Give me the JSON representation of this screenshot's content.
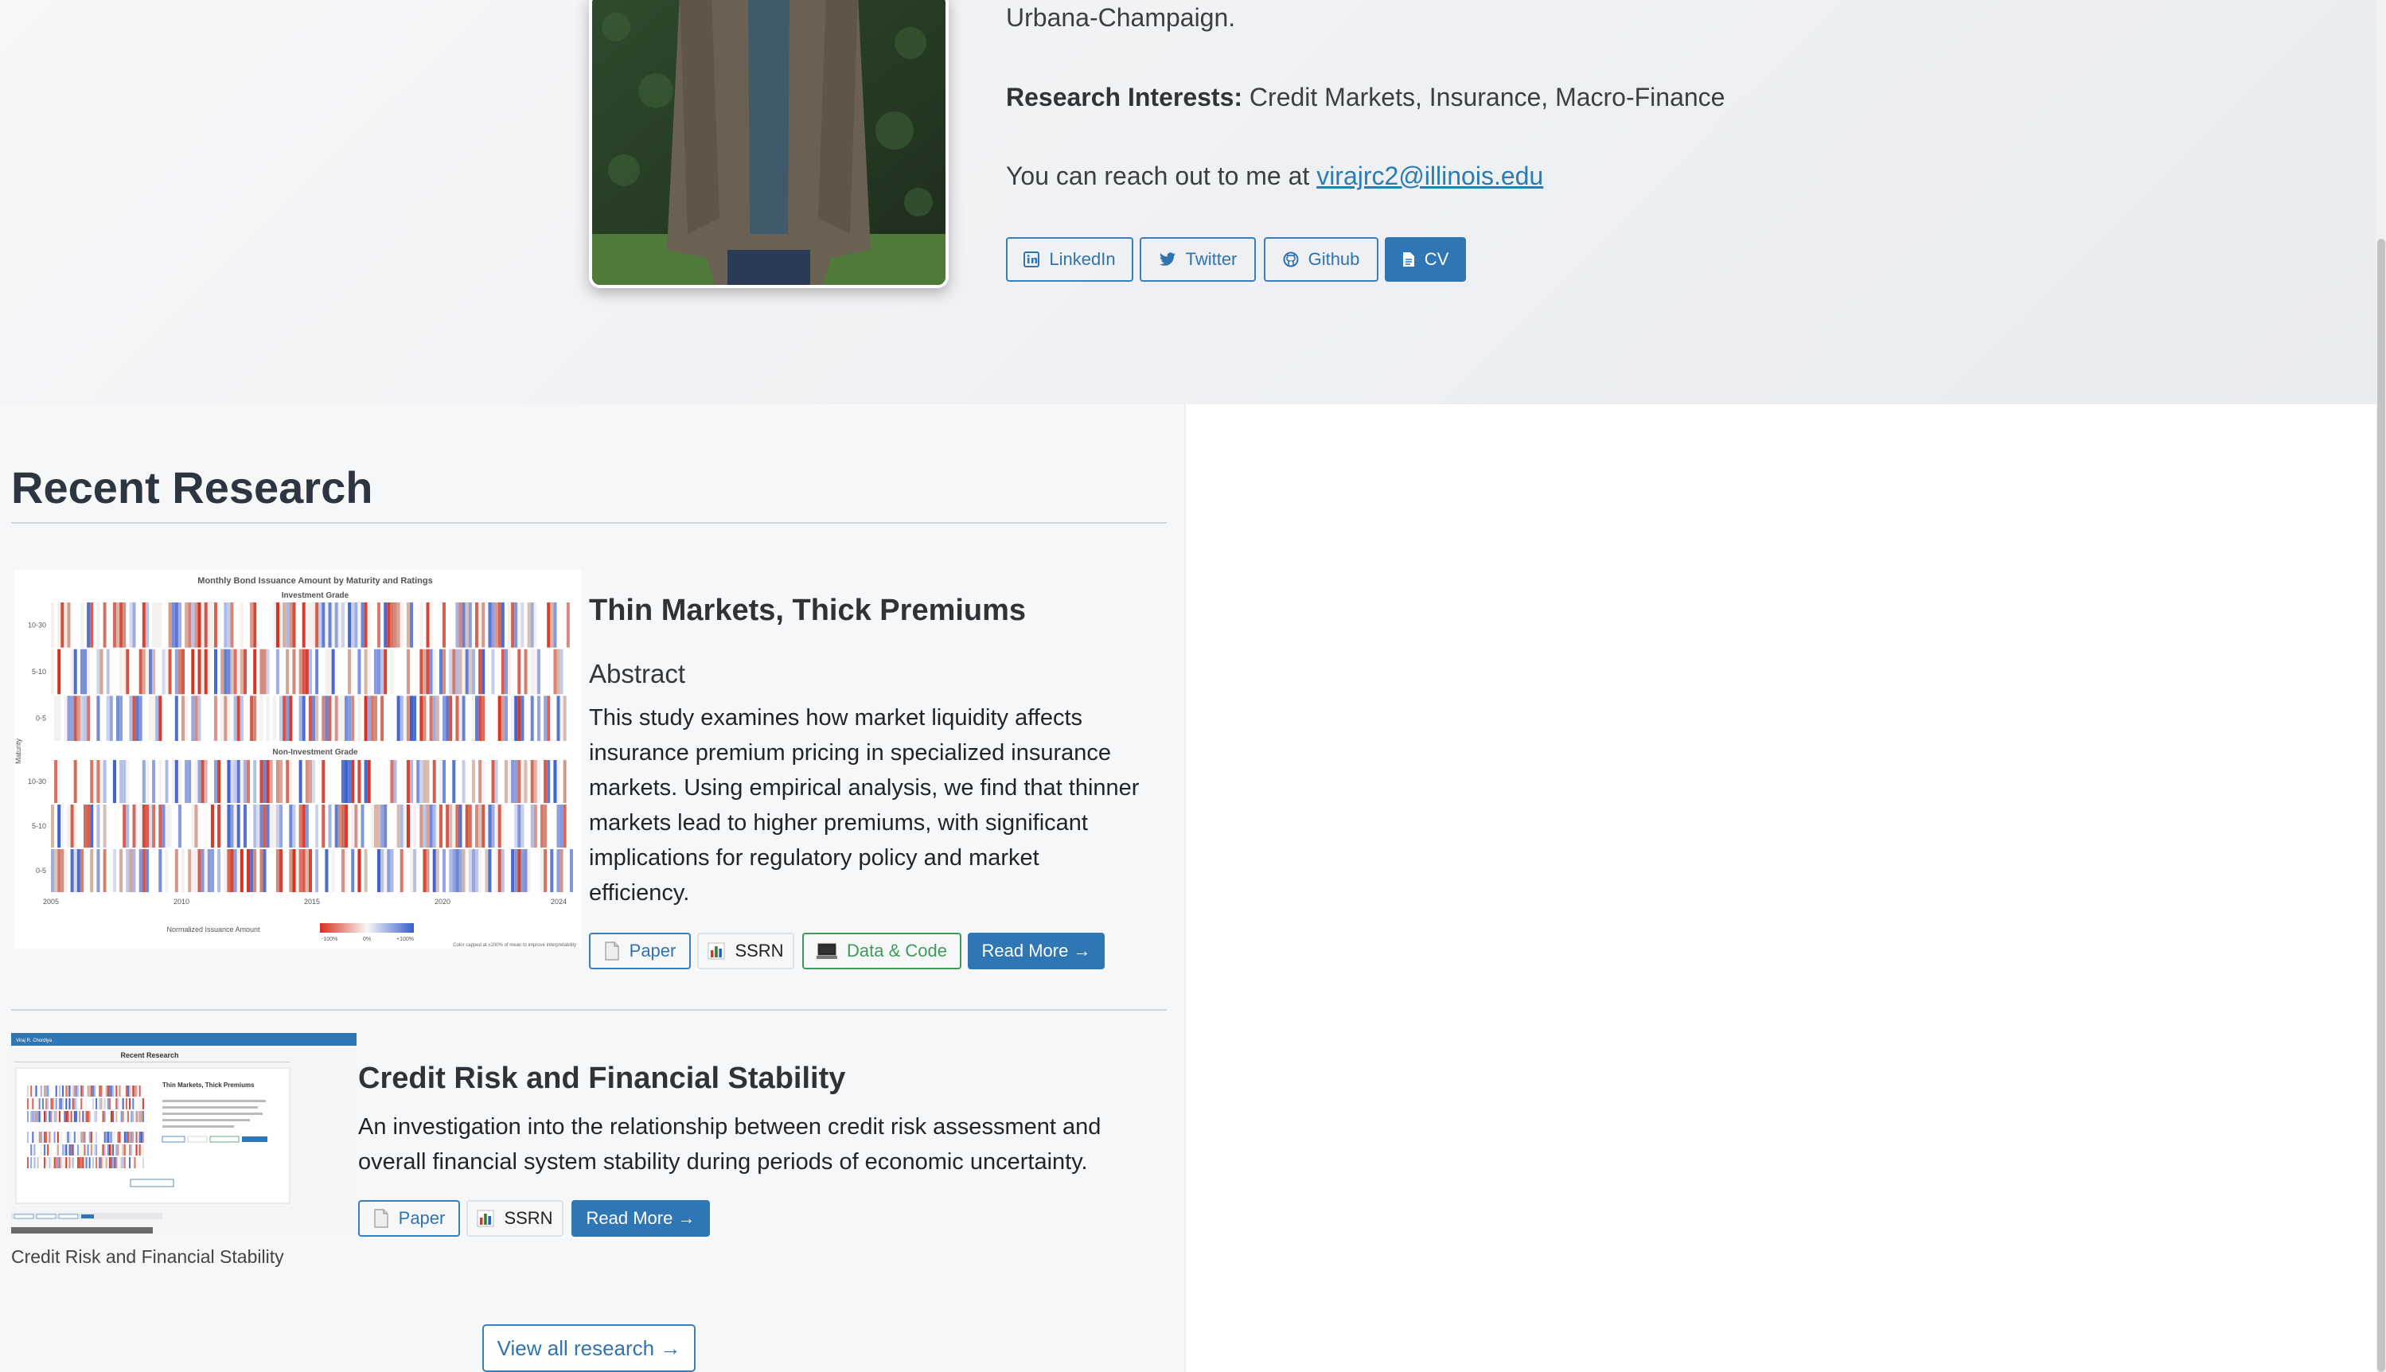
{
  "hero": {
    "affiliation_tail": "Urbana-Champaign.",
    "interests_label": "Research Interests",
    "interests_sep": ":",
    "interests_value": " Credit Markets, Insurance, Macro-Finance",
    "contact_prefix": "You can reach out to me at ",
    "email": "virajrc2@illinois.edu",
    "buttons": [
      {
        "label": "LinkedIn",
        "icon": "linkedin-icon"
      },
      {
        "label": "Twitter",
        "icon": "twitter-icon"
      },
      {
        "label": "Github",
        "icon": "github-icon"
      },
      {
        "label": "CV",
        "icon": "document-icon"
      }
    ]
  },
  "research": {
    "heading": "Recent Research",
    "items": [
      {
        "title": "Thin Markets, Thick Premiums",
        "abstract_heading": "Abstract",
        "abstract_lines": [
          "This study examines how market liquidity affects",
          "insurance premium pricing in specialized insurance",
          "markets. Using empirical analysis, we find that thinner",
          "markets lead to higher premiums, with significant",
          "implications for regulatory policy and market",
          "efficiency."
        ],
        "buttons": {
          "paper": "Paper",
          "ssrn": "SSRN",
          "data": "Data & Code",
          "read_more": "Read More →"
        },
        "thumbnail": {
          "title": "Monthly Bond Issuance Amount by Maturity and Ratings",
          "panel_top": "Investment Grade",
          "panel_bottom": "Non-Investment Grade",
          "ylabel": "Maturity",
          "row_labels": [
            "10-30",
            "5-10",
            "0-5"
          ],
          "years": [
            "2005",
            "2010",
            "2015",
            "2020",
            "2024"
          ],
          "legend_label": "Normalized Issuance Amount",
          "legend_ticks": [
            "-100%",
            "0%",
            "+100%"
          ],
          "note": "Color capped at ±200% of mean to improve interpretability"
        }
      },
      {
        "title": "Credit Risk and Financial Stability",
        "description_lines": [
          "An investigation into the relationship between credit risk assessment and",
          "overall financial system stability during periods of economic uncertainty."
        ],
        "buttons": {
          "paper": "Paper",
          "ssrn": "SSRN",
          "read_more": "Read More →"
        },
        "caption": "Credit Risk and Financial Stability",
        "thumbnail": {
          "nav_brand": "Viraj R. Chordiya",
          "heading": "Recent Research",
          "card_title": "Thin Markets, Thick Premiums"
        }
      }
    ],
    "view_all": "View all research →"
  }
}
